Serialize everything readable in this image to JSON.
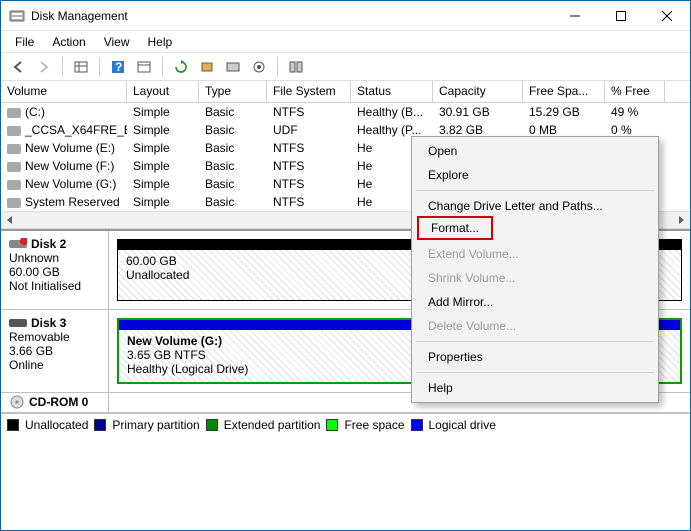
{
  "window": {
    "title": "Disk Management"
  },
  "menu": {
    "file": "File",
    "action": "Action",
    "view": "View",
    "help": "Help"
  },
  "grid": {
    "headers": [
      "Volume",
      "Layout",
      "Type",
      "File System",
      "Status",
      "Capacity",
      "Free Spa...",
      "% Free"
    ],
    "rows": [
      {
        "vol": "(C:)",
        "layout": "Simple",
        "type": "Basic",
        "fs": "NTFS",
        "status": "Healthy (B...",
        "cap": "30.91 GB",
        "free": "15.29 GB",
        "pct": "49 %"
      },
      {
        "vol": "_CCSA_X64FRE_E...",
        "layout": "Simple",
        "type": "Basic",
        "fs": "UDF",
        "status": "Healthy (P...",
        "cap": "3.82 GB",
        "free": "0 MB",
        "pct": "0 %"
      },
      {
        "vol": "New Volume (E:)",
        "layout": "Simple",
        "type": "Basic",
        "fs": "NTFS",
        "status": "He",
        "cap": "",
        "free": "",
        "pct": ""
      },
      {
        "vol": "New Volume (F:)",
        "layout": "Simple",
        "type": "Basic",
        "fs": "NTFS",
        "status": "He",
        "cap": "",
        "free": "",
        "pct": ""
      },
      {
        "vol": "New Volume (G:)",
        "layout": "Simple",
        "type": "Basic",
        "fs": "NTFS",
        "status": "He",
        "cap": "",
        "free": "",
        "pct": ""
      },
      {
        "vol": "System Reserved",
        "layout": "Simple",
        "type": "Basic",
        "fs": "NTFS",
        "status": "He",
        "cap": "",
        "free": "",
        "pct": ""
      }
    ]
  },
  "disks": {
    "d2": {
      "name": "Disk 2",
      "kind": "Unknown",
      "size": "60.00 GB",
      "state": "Not Initialised",
      "map_size": "60.00 GB",
      "map_state": "Unallocated"
    },
    "d3": {
      "name": "Disk 3",
      "kind": "Removable",
      "size": "3.66 GB",
      "state": "Online",
      "vol_name": "New Volume  (G:)",
      "vol_size": "3.65 GB NTFS",
      "vol_status": "Healthy (Logical Drive)"
    },
    "cd": {
      "name": "CD-ROM 0"
    }
  },
  "legend": {
    "unalloc": "Unallocated",
    "primary": "Primary partition",
    "ext": "Extended partition",
    "free": "Free space",
    "logical": "Logical drive"
  },
  "ctx": {
    "open": "Open",
    "explore": "Explore",
    "change": "Change Drive Letter and Paths...",
    "format": "Format...",
    "extend": "Extend Volume...",
    "shrink": "Shrink Volume...",
    "mirror": "Add Mirror...",
    "delete": "Delete Volume...",
    "props": "Properties",
    "help": "Help"
  }
}
